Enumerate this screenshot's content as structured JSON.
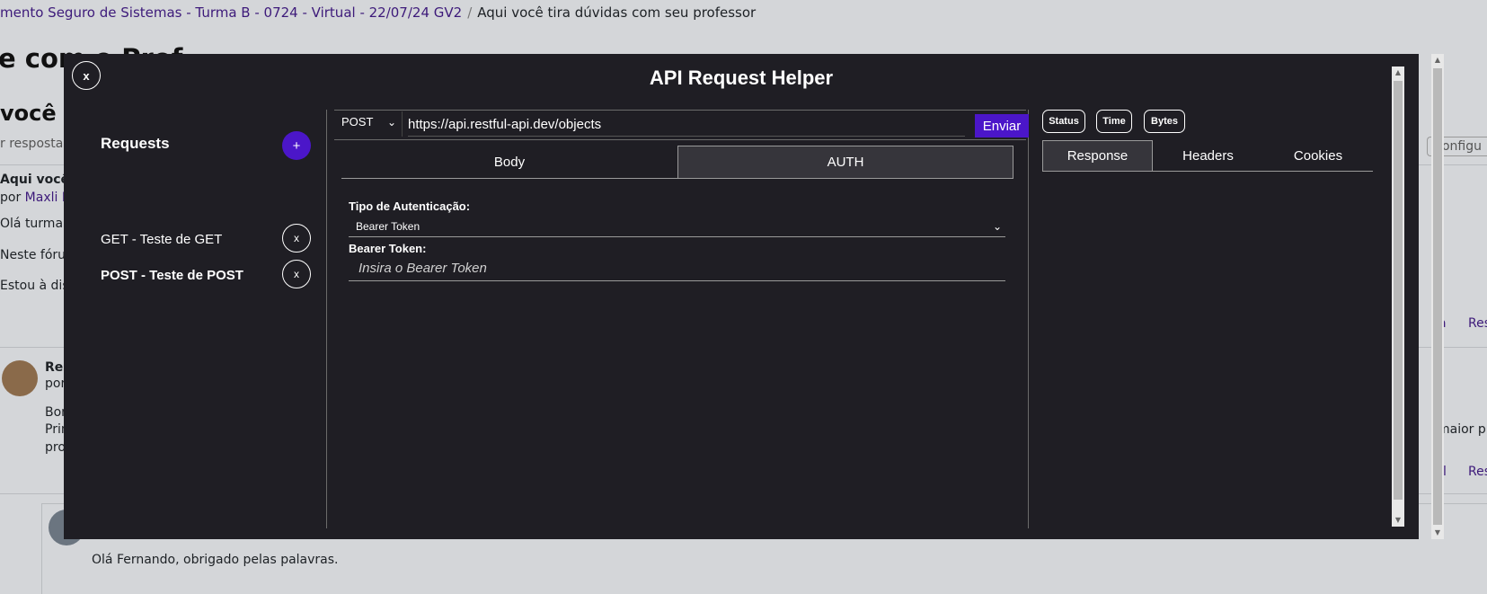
{
  "background": {
    "breadcrumb": {
      "course": "mento Seguro de Sistemas - Turma B - 0724 - Virtual - 22/07/24 GV2",
      "separator": "/",
      "current": "Aqui você tira dúvidas com seu professor"
    },
    "title": "e com o Prof",
    "subtitle": "você t",
    "filter": "r respostas",
    "config": "Configu",
    "post": {
      "title": "Aqui você t",
      "by_prefix": "por ",
      "author": "Maxli Bo",
      "line1": "Olá turma.",
      "line2": "Neste fórun",
      "line3": "Estou à disp"
    },
    "reply": {
      "title": "Re:",
      "by": "por",
      "line1": "Bom",
      "line2": "Prin",
      "line3": "pro",
      "right_text": "maior p"
    },
    "reply2": {
      "line1": "Olá Fernando, obrigado pelas palavras."
    },
    "right_links": [
      "a",
      "Res",
      "l",
      "Res"
    ]
  },
  "modal": {
    "title": "API Request Helper",
    "close_label": "x",
    "requests": {
      "title": "Requests",
      "add_label": "+",
      "delete_label": "x",
      "items": [
        {
          "label": "GET - Teste de GET",
          "active": false
        },
        {
          "label": "POST - Teste de POST",
          "active": true
        }
      ]
    },
    "request": {
      "method": "POST",
      "url": "https://api.restful-api.dev/objects",
      "send_label": "Enviar",
      "tabs": [
        {
          "label": "Body",
          "active": false
        },
        {
          "label": "AUTH",
          "active": true
        }
      ],
      "auth": {
        "type_label": "Tipo de Autenticação:",
        "type_value": "Bearer Token",
        "token_label": "Bearer Token:",
        "token_placeholder": "Insira o Bearer Token"
      }
    },
    "response": {
      "pills": [
        "Status",
        "Time",
        "Bytes"
      ],
      "tabs": [
        {
          "label": "Response",
          "active": true
        },
        {
          "label": "Headers",
          "active": false
        },
        {
          "label": "Cookies",
          "active": false
        }
      ]
    }
  },
  "colors": {
    "accent": "#4b16c9",
    "modal_bg": "#1f1e24",
    "link": "#3d1a7a"
  },
  "icons": {
    "chevron": "chevron-down-icon",
    "close": "close-icon",
    "add": "plus-icon"
  }
}
